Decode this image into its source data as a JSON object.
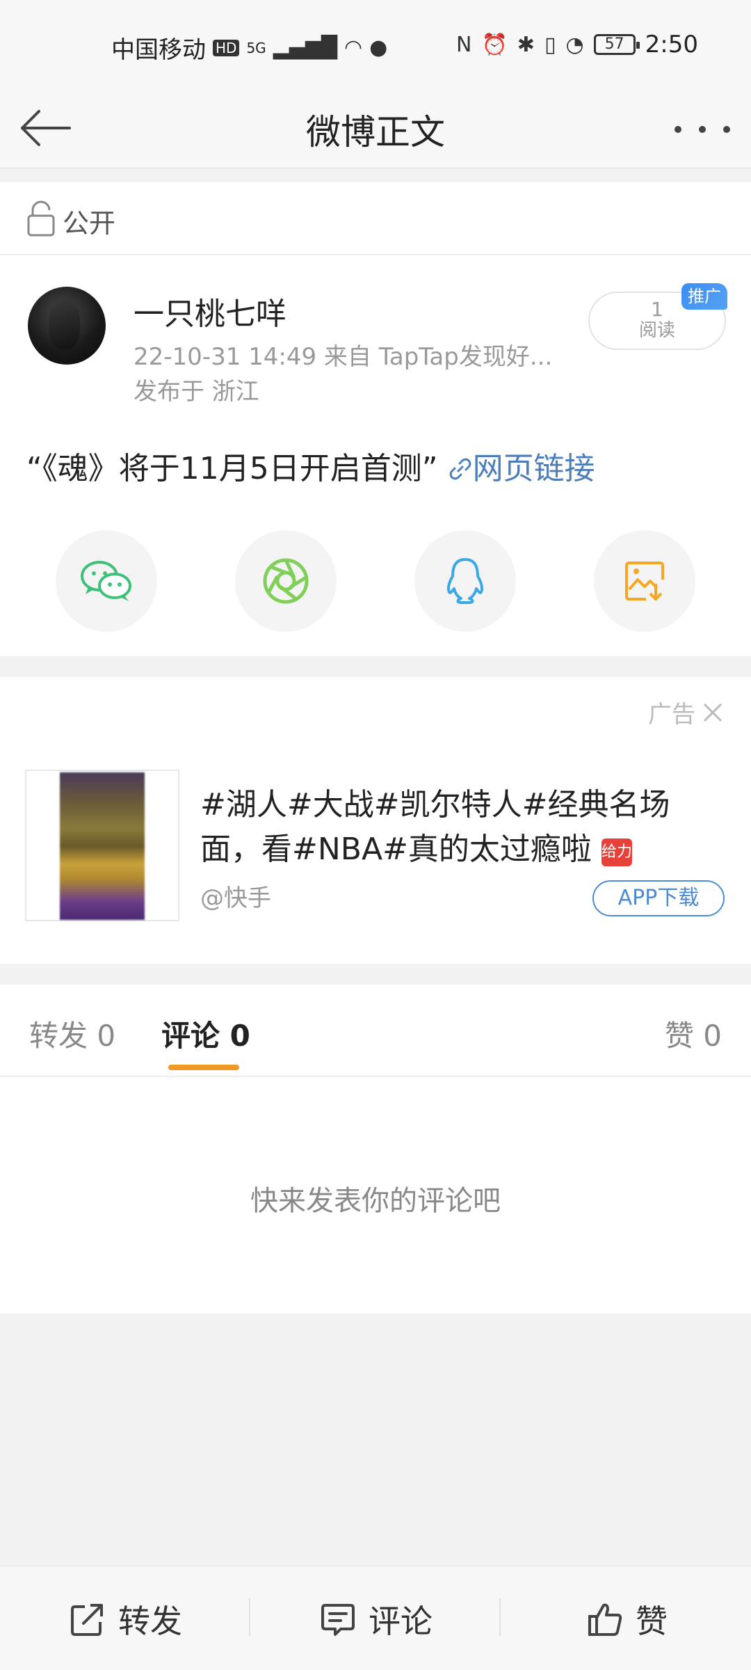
{
  "status_bar": {
    "carrier": "中国移动",
    "hd": "HD",
    "network": "5G",
    "battery": "57",
    "time": "2:50"
  },
  "nav": {
    "title": "微博正文"
  },
  "privacy": {
    "label": "公开"
  },
  "post": {
    "username": "一只桃七咩",
    "meta": "22-10-31 14:49   来自 TapTap发现好...",
    "location": "发布于 浙江",
    "read_count": "1",
    "read_label": "阅读",
    "promo_tag": "推广",
    "text_main": "“《魂》将于11月5日开启首测”",
    "text_link": "网页链接"
  },
  "ad": {
    "label": "广告",
    "title": "#湖人#大战#凯尔特人#经典名场面，看#NBA#真的太过瘾啦",
    "emoji_text": "给力",
    "source": "@快手",
    "button": "APP下载"
  },
  "tabs": {
    "repost": "转发 0",
    "comment": "评论 0",
    "like": "赞 0"
  },
  "comments": {
    "empty": "快来发表你的评论吧"
  },
  "bottom_bar": {
    "repost": "转发",
    "comment": "评论",
    "like": "赞"
  },
  "colors": {
    "accent_orange": "#f09a23",
    "link_blue": "#4c7fb9",
    "wechat_green": "#3fc07a",
    "moments_green": "#7fcf59",
    "qq_blue": "#3aa8e6",
    "save_orange": "#f5a623"
  }
}
